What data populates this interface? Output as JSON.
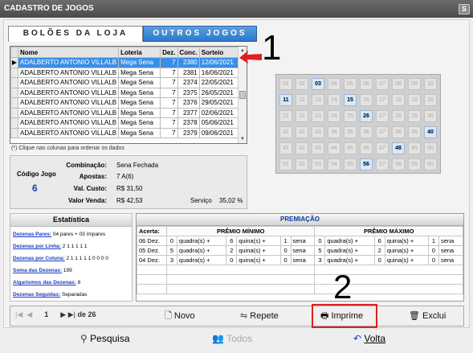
{
  "window": {
    "title": "CADASTRO DE JOGOS",
    "close": "S"
  },
  "tabs": {
    "boloes": "BOLÕES DA LOJA",
    "outros": "OUTROS JOGOS"
  },
  "grid": {
    "columns": [
      "Nome",
      "Loteria",
      "Dez.",
      "Conc.",
      "Sorteio"
    ],
    "rows": [
      [
        "ADALBERTO ANTONIO VILLALB",
        "Mega Sena",
        "7",
        "2380",
        "12/06/2021"
      ],
      [
        "ADALBERTO ANTONIO VILLALB",
        "Mega Sena",
        "7",
        "2381",
        "16/06/2021"
      ],
      [
        "ADALBERTO ANTONIO VILLALB",
        "Mega Sena",
        "7",
        "2374",
        "22/05/2021"
      ],
      [
        "ADALBERTO ANTONIO VILLALB",
        "Mega Sena",
        "7",
        "2375",
        "26/05/2021"
      ],
      [
        "ADALBERTO ANTONIO VILLALB",
        "Mega Sena",
        "7",
        "2376",
        "29/05/2021"
      ],
      [
        "ADALBERTO ANTONIO VILLALB",
        "Mega Sena",
        "7",
        "2377",
        "02/06/2021"
      ],
      [
        "ADALBERTO ANTONIO VILLALB",
        "Mega Sena",
        "7",
        "2378",
        "05/06/2021"
      ],
      [
        "ADALBERTO ANTONIO VILLALB",
        "Mega Sena",
        "7",
        "2379",
        "09/06/2021"
      ]
    ],
    "note": "(*) Clique nas colunas para ordenar os dados"
  },
  "annotations": {
    "one": "1",
    "two": "2"
  },
  "info": {
    "codigo_label": "Código Jogo",
    "codigo_value": "6",
    "combinacao_label": "Combinação:",
    "combinacao_value": "Sena Fechada",
    "apostas_label": "Apostas:",
    "apostas_value": "7 A(6)",
    "custo_label": "Val. Custo:",
    "custo_value": "R$ 31,50",
    "venda_label": "Valor Venda:",
    "venda_value": "R$ 42,53",
    "servico_label": "Serviço",
    "servico_value": "35,02 %"
  },
  "board": {
    "numbers": [
      "01",
      "02",
      "03",
      "04",
      "05",
      "06",
      "07",
      "08",
      "09",
      "10",
      "11",
      "12",
      "13",
      "14",
      "15",
      "16",
      "17",
      "18",
      "19",
      "20",
      "21",
      "22",
      "23",
      "24",
      "25",
      "26",
      "27",
      "28",
      "29",
      "30",
      "31",
      "32",
      "33",
      "34",
      "35",
      "36",
      "37",
      "38",
      "39",
      "40",
      "41",
      "42",
      "43",
      "44",
      "45",
      "46",
      "47",
      "48",
      "49",
      "50",
      "51",
      "52",
      "53",
      "54",
      "55",
      "56",
      "57",
      "58",
      "59",
      "60"
    ],
    "selected": [
      "03",
      "11",
      "15",
      "26",
      "40",
      "48",
      "56"
    ]
  },
  "estatistica": {
    "title": "Estatística",
    "items": [
      {
        "key": "Dezenas Pares:",
        "value": " 04 pares + 03 ímpares"
      },
      {
        "key": "Dezenas por Linha:",
        "value": " 2 1 1 1 1 1"
      },
      {
        "key": "Dezenas por Coluna:",
        "value": " 2 1 1 1 1 1 0 0 0 0"
      },
      {
        "key": "Soma das Dezenas:",
        "value": " 199"
      },
      {
        "key": "Algarismos das Dezenas:",
        "value": " 8"
      },
      {
        "key": "Dezenas Seguidas:",
        "value": " Separadas"
      }
    ]
  },
  "premiacao": {
    "title": "PREMIAÇÃO",
    "acerta": "Acerta:",
    "min_header": "PRÊMIO MÍNIMO",
    "max_header": "PRÊMIO MÁXIMO",
    "rows": [
      {
        "label": "06 Dez.",
        "min": [
          "0",
          "quadra(s) +",
          "6",
          "quina(s) +",
          "1",
          "sena"
        ],
        "max": [
          "0",
          "quadra(s) +",
          "6",
          "quina(s) +",
          "1",
          "sena"
        ]
      },
      {
        "label": "05 Dez.",
        "min": [
          "5",
          "quadra(s) +",
          "2",
          "quina(s) +",
          "0",
          "sena"
        ],
        "max": [
          "5",
          "quadra(s) +",
          "2",
          "quina(s) +",
          "0",
          "sena"
        ]
      },
      {
        "label": "04 Dez.",
        "min": [
          "3",
          "quadra(s) +",
          "0",
          "quina(s) +",
          "0",
          "sena"
        ],
        "max": [
          "3",
          "quadra(s) +",
          "0",
          "quina(s) +",
          "0",
          "sena"
        ]
      }
    ]
  },
  "toolbar": {
    "page": "1",
    "of_pages": "de 26",
    "novo": "Novo",
    "repete": "Repete",
    "imprime": "Imprime",
    "exclui": "Exclui"
  },
  "bottom": {
    "pesquisa": "Pesquisa",
    "todos": "Todos",
    "volta": "Volta"
  }
}
